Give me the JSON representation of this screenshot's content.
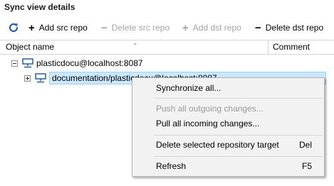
{
  "panel": {
    "title": "Sync view details"
  },
  "toolbar": {
    "refresh_icon": "refresh-icon",
    "add_src": "Add src repo",
    "delete_src": "Delete src repo",
    "add_dst": "Add dst repo",
    "delete_dst": "Delete dst repo"
  },
  "columns": {
    "object_name": "Object name",
    "comment": "Comment"
  },
  "tree": {
    "root": {
      "label": "plasticdocu@localhost:8087",
      "icon": "server-icon",
      "expanded": true
    },
    "child": {
      "label": "documentation/plasticdocu@localhost:8087",
      "icon": "server-icon",
      "expanded": false,
      "selected": true
    }
  },
  "context_menu": {
    "items": [
      {
        "label": "Synchronize all...",
        "shortcut": "",
        "enabled": true
      },
      {
        "label": "Push all outgoing changes...",
        "shortcut": "",
        "enabled": false
      },
      {
        "label": "Pull all incoming changes...",
        "shortcut": "",
        "enabled": true
      },
      {
        "label": "Delete selected repository target",
        "shortcut": "Del",
        "enabled": true
      },
      {
        "label": "Refresh",
        "shortcut": "F5",
        "enabled": true
      }
    ]
  },
  "colors": {
    "selection_bg": "#cce8ff",
    "selection_border": "#99d1ff",
    "menu_bg": "#f2f2f2",
    "icon_blue": "#2c5f9e"
  }
}
